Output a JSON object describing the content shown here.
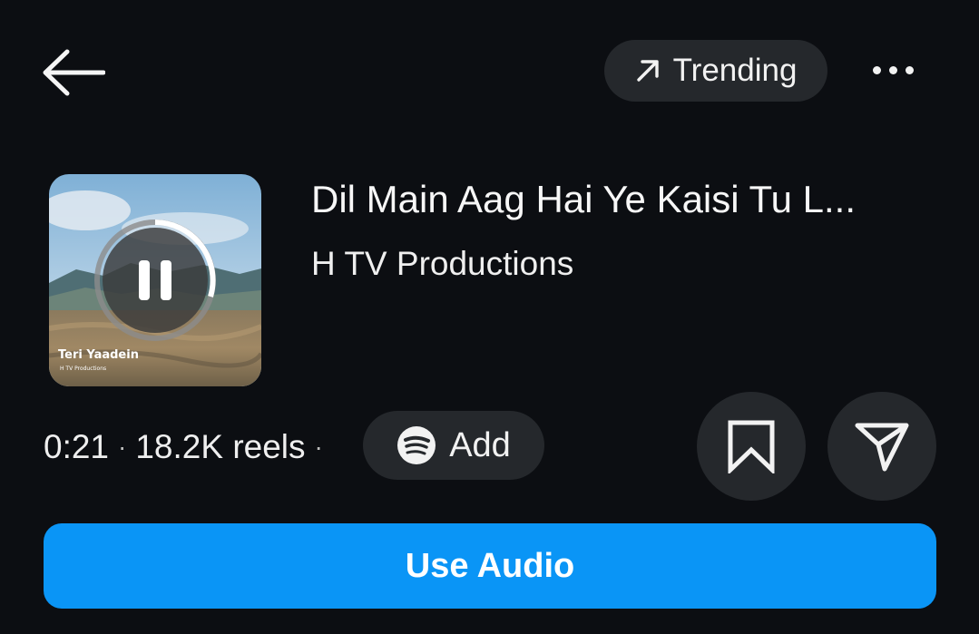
{
  "header": {
    "back_icon": "arrow-left-icon",
    "trending_icon": "arrow-up-right-icon",
    "trending_label": "Trending",
    "more_icon": "more-horizontal-icon"
  },
  "track": {
    "cover_title": "Teri Yaadein",
    "cover_subtitle": "H TV Productions",
    "playback_icon": "pause-icon",
    "title": "Dil Main Aag Hai Ye Kaisi Tu L...",
    "artist": "H TV Productions"
  },
  "meta": {
    "duration": "0:21",
    "separator": "·",
    "reels_count": "18.2K reels",
    "add_label": "Add",
    "add_icon": "spotify-icon"
  },
  "actions": {
    "save_icon": "bookmark-icon",
    "share_icon": "send-icon",
    "use_audio_label": "Use Audio"
  },
  "colors": {
    "background": "#0c0e12",
    "pill": "#25282c",
    "accent": "#0a95f6"
  }
}
